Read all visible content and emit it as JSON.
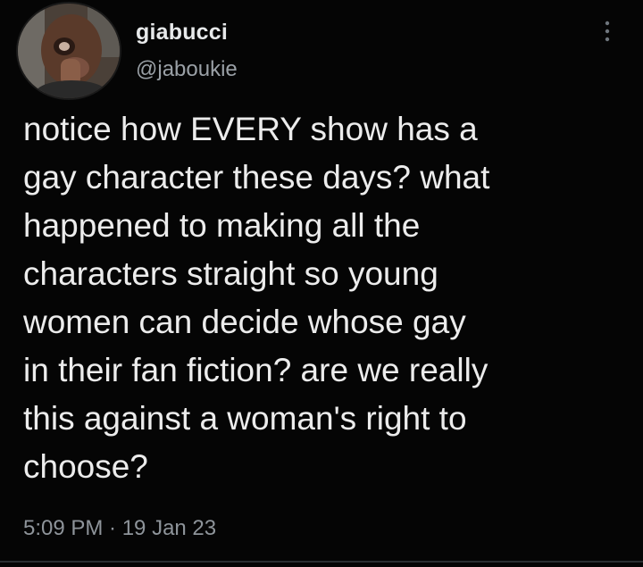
{
  "tweet": {
    "author": {
      "display_name": "giabucci",
      "handle": "@jaboukie"
    },
    "text": "notice how EVERY show has a\ngay character these days? what\nhappened to making all the\ncharacters straight so young\nwomen can decide whose gay\nin their fan fiction? are we really\nthis against a woman's right to\nchoose?",
    "timestamp": "5:09 PM · 19 Jan 23"
  },
  "icons": {
    "avatar": "profile-photo",
    "more": "vertical-ellipsis-icon"
  },
  "colors": {
    "background": "#050505",
    "text": "#ececec",
    "secondary_text": "#8e949a"
  }
}
